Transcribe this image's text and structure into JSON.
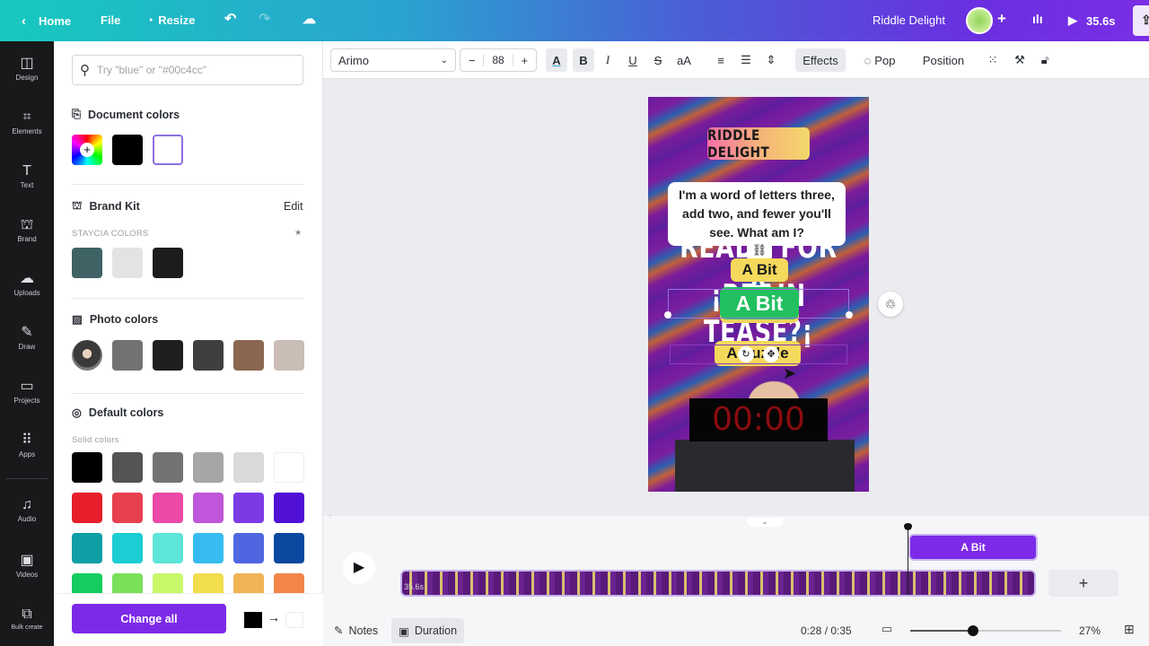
{
  "topbar": {
    "home": "Home",
    "file": "File",
    "resize": "Resize",
    "title": "Riddle Delight",
    "duration": "35.6s"
  },
  "rail": [
    {
      "label": "Design",
      "icon": "design-icon"
    },
    {
      "label": "Elements",
      "icon": "elements-icon"
    },
    {
      "label": "Text",
      "icon": "text-icon"
    },
    {
      "label": "Brand",
      "icon": "brand-icon"
    },
    {
      "label": "Uploads",
      "icon": "uploads-icon"
    },
    {
      "label": "Draw",
      "icon": "draw-icon"
    },
    {
      "label": "Projects",
      "icon": "projects-icon"
    },
    {
      "label": "Apps",
      "icon": "apps-icon"
    },
    {
      "label": "Audio",
      "icon": "audio-icon"
    },
    {
      "label": "Videos",
      "icon": "videos-icon"
    },
    {
      "label": "Bulk create",
      "icon": "bulk-create-icon"
    }
  ],
  "panel": {
    "search_placeholder": "Try \"blue\" or \"#00c4cc\"",
    "document_colors": {
      "title": "Document colors",
      "colors": [
        "#000000",
        "#ffffff"
      ]
    },
    "brand_kit": {
      "title": "Brand Kit",
      "edit": "Edit",
      "subtitle": "STAYCIA COLORS",
      "colors": [
        "#3f6264",
        "#e3e3e3",
        "#1c1c1c"
      ]
    },
    "photo_colors": {
      "title": "Photo colors",
      "colors": [
        "#727272",
        "#1f1f1f",
        "#3f3f3f",
        "#8a6650",
        "#c9bdb5"
      ]
    },
    "default_colors": {
      "title": "Default colors",
      "subtitle": "Solid colors",
      "colors": [
        "#000000",
        "#545454",
        "#737373",
        "#a6a6a6",
        "#d9d9d9",
        "#ffffff",
        "#e61f2b",
        "#e7404f",
        "#ec48a8",
        "#c056d9",
        "#7c3ae6",
        "#5010d6",
        "#0e9ea5",
        "#1ccdd3",
        "#5ce5d8",
        "#36bcf0",
        "#4e67e0",
        "#0b48a0",
        "#15cd5f",
        "#7ae05a",
        "#c8f86a",
        "#f2dd4d",
        "#f0b455",
        "#f2854a"
      ]
    },
    "change_all": "Change all",
    "change_from": "#000000",
    "change_to": "#ffffff"
  },
  "toolbar": {
    "font": "Arimo",
    "font_size": "88",
    "effects": "Effects",
    "animate": "Pop",
    "position": "Position"
  },
  "canvas": {
    "title_badge": "RIDDLE DELIGHT",
    "riddle": "I'm a word of letters three, add two, and fewer you'll see. What am I?",
    "headline_1": "READY FOR A",
    "headline_2": "¡BRAIN TEASE?¡",
    "answer_1": "A Bit",
    "answer_2": "A Bit",
    "answer_3": "A Puzzle",
    "timer": "00:00"
  },
  "timeline": {
    "clip_label": "A Bit",
    "track_duration": "35.6s",
    "time": "0:28 / 0:35",
    "zoom": "27%",
    "notes": "Notes",
    "duration": "Duration",
    "zoom_level": 0.27
  }
}
